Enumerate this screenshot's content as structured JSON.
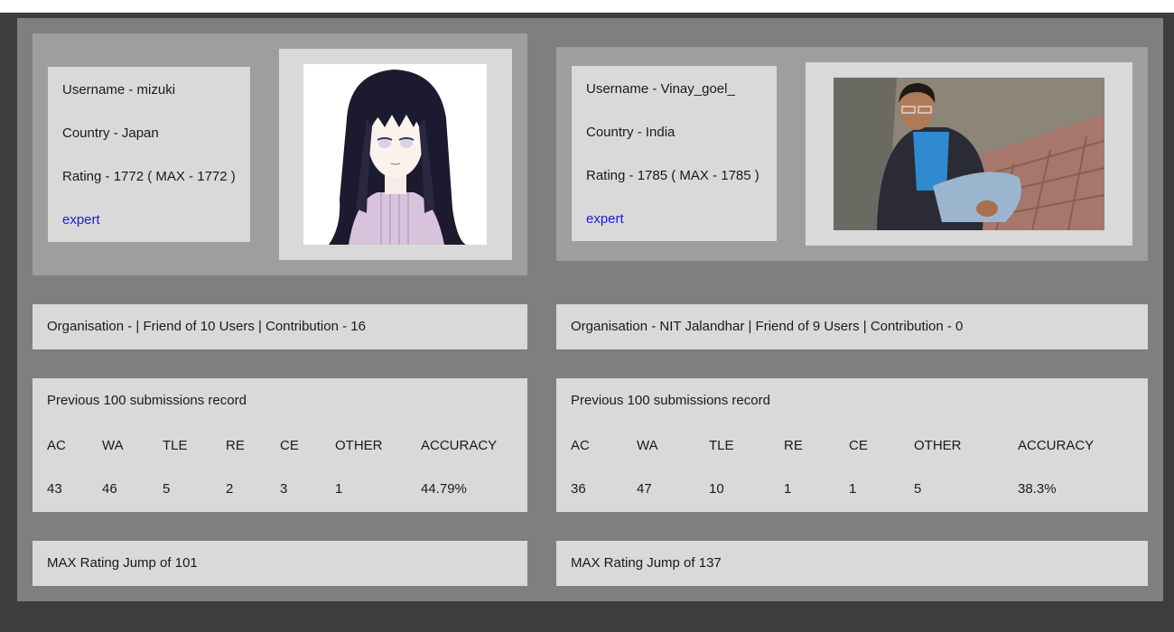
{
  "users": [
    {
      "username_line": "Username - mizuki",
      "country_line": "Country - Japan",
      "rating_line": "Rating - 1772 ( MAX - 1772 )",
      "rank": "expert",
      "org_line": "Organisation - | Friend of 10 Users | Contribution - 16",
      "submissions_title": "Previous 100 submissions record",
      "verdict_headers": [
        "AC",
        "WA",
        "TLE",
        "RE",
        "CE",
        "OTHER",
        "ACCURACY"
      ],
      "verdict_values": [
        "43",
        "46",
        "5",
        "2",
        "3",
        "1",
        "44.79%"
      ],
      "max_jump_line": "MAX Rating Jump of 101"
    },
    {
      "username_line": "Username - Vinay_goel_",
      "country_line": "Country - India",
      "rating_line": "Rating - 1785 ( MAX - 1785 )",
      "rank": "expert",
      "org_line": "Organisation - NIT Jalandhar | Friend of 9 Users | Contribution - 0",
      "submissions_title": "Previous 100 submissions record",
      "verdict_headers": [
        "AC",
        "WA",
        "TLE",
        "RE",
        "CE",
        "OTHER",
        "ACCURACY"
      ],
      "verdict_values": [
        "36",
        "47",
        "10",
        "1",
        "1",
        "5",
        "38.3%"
      ],
      "max_jump_line": "MAX Rating Jump of 137"
    }
  ],
  "colors": {
    "rank_expert": "#1a1adb",
    "outer_frame": "#3d3d3d",
    "board": "#7f7f7f",
    "panel": "#9e9e9e",
    "card": "#d9d9d9"
  }
}
